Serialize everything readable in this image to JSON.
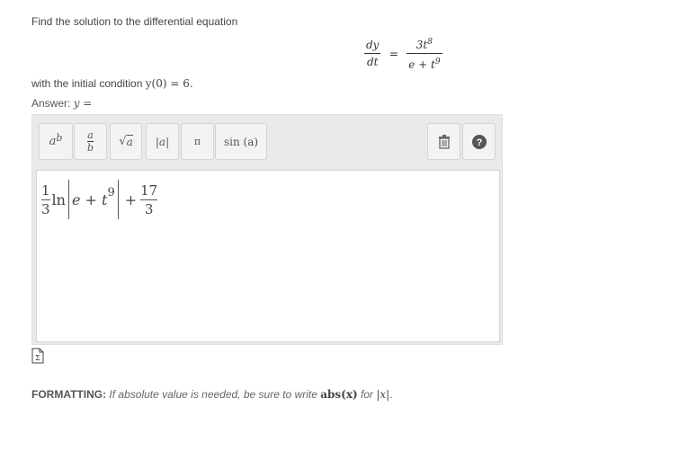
{
  "question": {
    "prompt": "Find the solution to the differential equation",
    "equation": {
      "lhs_num": "dy",
      "lhs_den": "dt",
      "eq": "=",
      "rhs_num_base": "3t",
      "rhs_num_exp": "8",
      "rhs_den_base": "e + t",
      "rhs_den_exp": "9"
    },
    "condition_prefix": "with the initial condition ",
    "condition_math": "y(0) = 6.",
    "answer_label": "Answer: ",
    "answer_var": "y ="
  },
  "toolbar": {
    "power": {
      "base": "a",
      "exp": "b"
    },
    "fraction": {
      "num": "a",
      "den": "b"
    },
    "sqrt": {
      "symbol": "√",
      "arg": "a"
    },
    "abs": "|a|",
    "pi": "π",
    "sin": "sin (a)",
    "trash_icon": "trash-icon",
    "help_icon": "help-icon"
  },
  "answer_expression": {
    "coef_num": "1",
    "coef_den": "3",
    "ln": "ln",
    "inner_base": "e + t",
    "inner_exp": "9",
    "plus": "+",
    "const_num": "17",
    "const_den": "3"
  },
  "footer": {
    "formatting_label": "FORMATTING:",
    "formatting_text": " If absolute value is needed, be sure to write ",
    "formatting_code": "abs(x)",
    "formatting_for": " for ",
    "formatting_abs": "|x|",
    "formatting_end": "."
  }
}
